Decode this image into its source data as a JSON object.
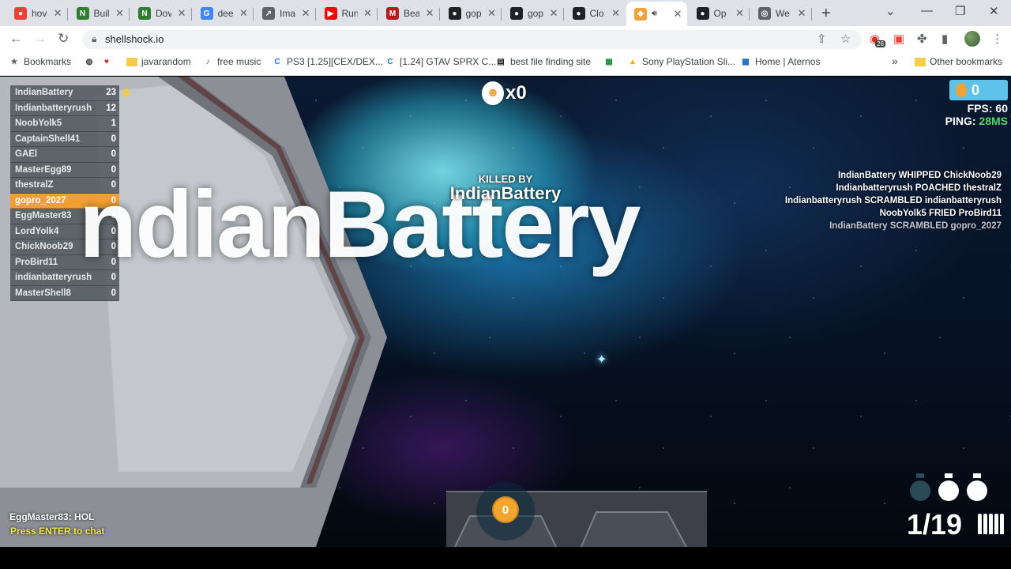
{
  "browser": {
    "tabs": [
      {
        "title": "hov",
        "fav_color": "#ea4335",
        "fav_glyph": "●"
      },
      {
        "title": "Buil",
        "fav_color": "#2e7d32",
        "fav_glyph": "N"
      },
      {
        "title": "Dov",
        "fav_color": "#2e7d32",
        "fav_glyph": "N"
      },
      {
        "title": "dee",
        "fav_color": "#4285f4",
        "fav_glyph": "G"
      },
      {
        "title": "Ima",
        "fav_color": "#5f6368",
        "fav_glyph": "↗"
      },
      {
        "title": "Run",
        "fav_color": "#ff0000",
        "fav_glyph": "▶"
      },
      {
        "title": "Bea",
        "fav_color": "#b71c1c",
        "fav_glyph": "M"
      },
      {
        "title": "gop",
        "fav_color": "#202124",
        "fav_glyph": "●"
      },
      {
        "title": "gop",
        "fav_color": "#202124",
        "fav_glyph": "●"
      },
      {
        "title": "Clo",
        "fav_color": "#202124",
        "fav_glyph": "●"
      },
      {
        "title": "",
        "fav_color": "#f2a23a",
        "fav_glyph": "◆",
        "active": true
      },
      {
        "title": "Op",
        "fav_color": "#202124",
        "fav_glyph": "●"
      },
      {
        "title": "We",
        "fav_color": "#5f6368",
        "fav_glyph": "◎"
      }
    ],
    "url": "shellshock.io",
    "extension_badge": "26",
    "bookmarks": [
      {
        "label": "Bookmarks",
        "icon": "star-list-icon"
      },
      {
        "label": "",
        "icon": "globe-icon"
      },
      {
        "label": "",
        "icon": "heart-icon"
      },
      {
        "label": "javarandom",
        "icon": "folder-icon"
      },
      {
        "label": "free music",
        "icon": "music-icon"
      },
      {
        "label": "PS3 [1.25][CEX/DEX...",
        "icon": "c-icon"
      },
      {
        "label": "[1.24] GTAV SPRX C...",
        "icon": "c-icon"
      },
      {
        "label": "best file finding site",
        "icon": "site-icon"
      },
      {
        "label": "",
        "icon": "green-icon"
      },
      {
        "label": "Sony PlayStation Sli...",
        "icon": "bag-icon"
      },
      {
        "label": "Home | Aternos",
        "icon": "aternos-icon"
      }
    ],
    "other_bookmarks": "Other bookmarks",
    "overflow": "»"
  },
  "game": {
    "scoreboard": [
      {
        "name": "IndianBattery",
        "score": "23",
        "style": "top"
      },
      {
        "name": "Indianbatteryrush",
        "score": "12",
        "style": ""
      },
      {
        "name": "NoobYolk5",
        "score": "1",
        "style": ""
      },
      {
        "name": "CaptainShell41",
        "score": "0",
        "style": ""
      },
      {
        "name": "GAEl",
        "score": "0",
        "style": ""
      },
      {
        "name": "MasterEgg89",
        "score": "0",
        "style": ""
      },
      {
        "name": "thestralZ",
        "score": "0",
        "style": ""
      },
      {
        "name": "gopro_2027",
        "score": "0",
        "style": "hl"
      },
      {
        "name": "EggMaster83",
        "score": "0",
        "style": ""
      },
      {
        "name": "LordYolk4",
        "score": "0",
        "style": ""
      },
      {
        "name": "ChickNoob29",
        "score": "0",
        "style": ""
      },
      {
        "name": "ProBird11",
        "score": "0",
        "style": ""
      },
      {
        "name": "indianbatteryrush",
        "score": "0",
        "style": ""
      },
      {
        "name": "MasterShell8",
        "score": "0",
        "style": ""
      }
    ],
    "kill_streak": "x0",
    "eggs": "0",
    "fps_label": "FPS:",
    "fps_value": "60",
    "ping_label": "PING:",
    "ping_value": "28MS",
    "kill_feed": [
      "IndianBattery WHIPPED ChickNoob29",
      "Indianbatteryrush POACHED thestralZ",
      "Indianbatteryrush SCRAMBLED indianbatteryrush",
      "NoobYolk5 FRIED ProBird11",
      "IndianBattery SCRAMBLED gopro_2027"
    ],
    "killed_by_label": "KILLED BY",
    "killer_name": "IndianBattery",
    "killer_big": "ndianBattery",
    "chat_message": "EggMaster83: HOL",
    "chat_prompt": "Press ENTER to chat",
    "ammo": "1/19",
    "coin_count": "0"
  }
}
